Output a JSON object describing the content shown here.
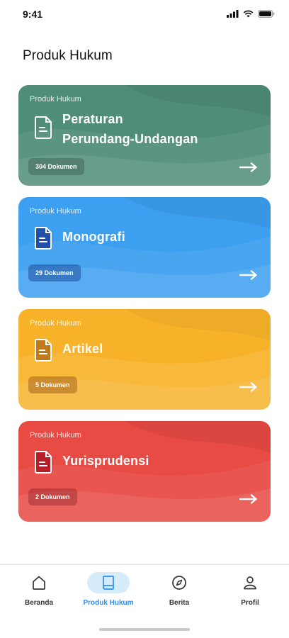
{
  "status_bar": {
    "time": "9:41"
  },
  "page": {
    "title": "Produk Hukum"
  },
  "theme": {
    "active_color": "#2f8df0",
    "active_pill": "#d6ecfb",
    "inactive_color": "#333333"
  },
  "cards": [
    {
      "label": "Produk Hukum",
      "title_line1": "Peraturan",
      "title_line2": "Perundang-Undangan",
      "count": "304 Dokumen",
      "color": "#4f8d78",
      "icon": "document-icon"
    },
    {
      "label": "Produk Hukum",
      "title_line1": "Monografi",
      "title_line2": "",
      "count": "29 Dokumen",
      "color": "#3d9ff0",
      "icon": "document-icon"
    },
    {
      "label": "Produk Hukum",
      "title_line1": "Artikel",
      "title_line2": "",
      "count": "5 Dokumen",
      "color": "#f8b22a",
      "icon": "document-icon"
    },
    {
      "label": "Produk Hukum",
      "title_line1": "Yurisprudensi",
      "title_line2": "",
      "count": "2 Dokumen",
      "color": "#e84a44",
      "icon": "document-icon"
    }
  ],
  "nav": [
    {
      "label": "Beranda",
      "icon": "home-icon",
      "active": false
    },
    {
      "label": "Produk Hukum",
      "icon": "book-icon",
      "active": true
    },
    {
      "label": "Berita",
      "icon": "compass-icon",
      "active": false
    },
    {
      "label": "Profil",
      "icon": "user-icon",
      "active": false
    }
  ]
}
